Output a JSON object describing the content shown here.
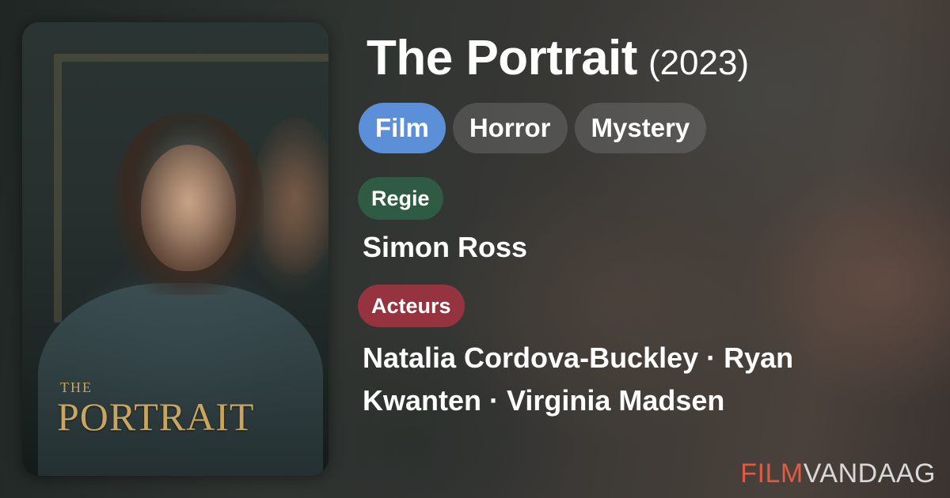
{
  "movie": {
    "title": "The Portrait",
    "year": "(2023)"
  },
  "poster": {
    "title_small": "THE",
    "title_large": "PORTRAIT"
  },
  "genres": [
    "Film",
    "Horror",
    "Mystery"
  ],
  "director": {
    "label": "Regie",
    "names": "Simon Ross"
  },
  "cast": {
    "label": "Acteurs",
    "names": "Natalia Cordova-Buckley · Ryan Kwanten · Virginia Madsen"
  },
  "brand": {
    "part1": "FILM",
    "part2": "VANDAAG"
  },
  "colors": {
    "genre_primary": "#5b8fd7",
    "genre_default": "rgba(120,120,120,0.42)",
    "regie_badge": "#2f5b45",
    "acteurs_badge": "#95343f",
    "brand_film": "#e05a44",
    "brand_vandaag": "#d8d8d8"
  }
}
